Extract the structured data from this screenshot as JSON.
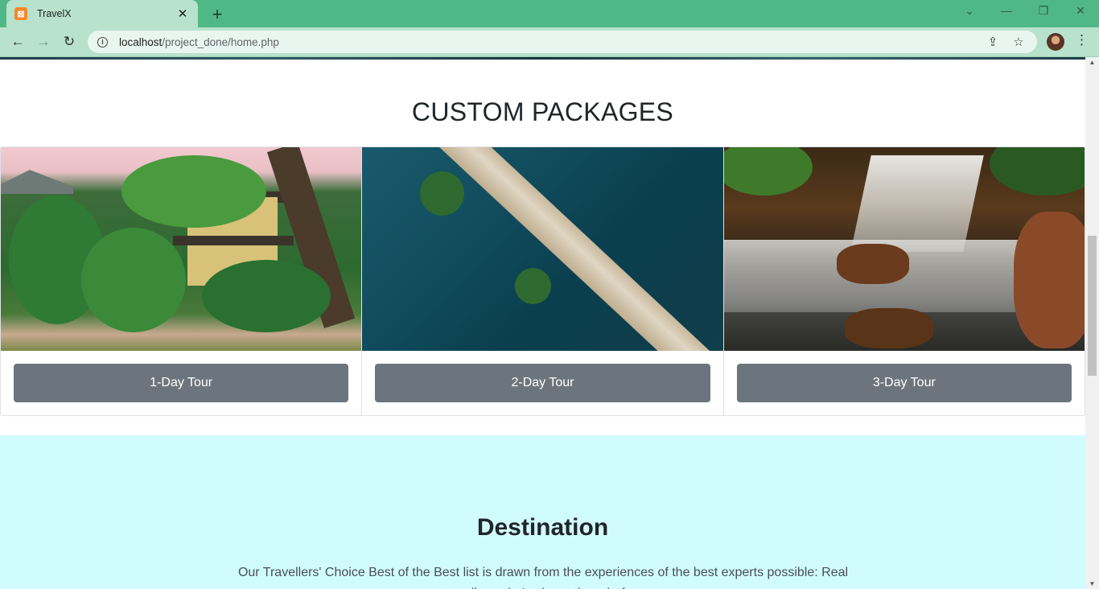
{
  "browser": {
    "tab_title": "TravelX",
    "tab_close": "✕",
    "new_tab": "+",
    "url_host": "localhost",
    "url_path": "/project_done/home.php",
    "controls": {
      "dropdown": "⌄",
      "minimize": "—",
      "restore": "❐",
      "close": "✕"
    },
    "icons": {
      "back": "←",
      "forward": "→",
      "reload": "↻",
      "info": "i",
      "share": "⇪",
      "star": "☆",
      "menu": "⋮"
    }
  },
  "page": {
    "packages": {
      "title": "CUSTOM PACKAGES",
      "cards": [
        {
          "button": "1-Day Tour"
        },
        {
          "button": "2-Day Tour"
        },
        {
          "button": "3-Day Tour"
        }
      ]
    },
    "destination": {
      "title": "Destination",
      "text": "Our Travellers' Choice Best of the Best list is drawn from the experiences of the best experts possible: Real travellers who've been there before"
    }
  },
  "scrollbar": {
    "up": "▲",
    "down": "▼"
  },
  "colors": {
    "titlebar": "#50b886",
    "toolbar": "#b8e2cc",
    "button": "#6c757d",
    "destination_bg": "#d0fcfd"
  }
}
